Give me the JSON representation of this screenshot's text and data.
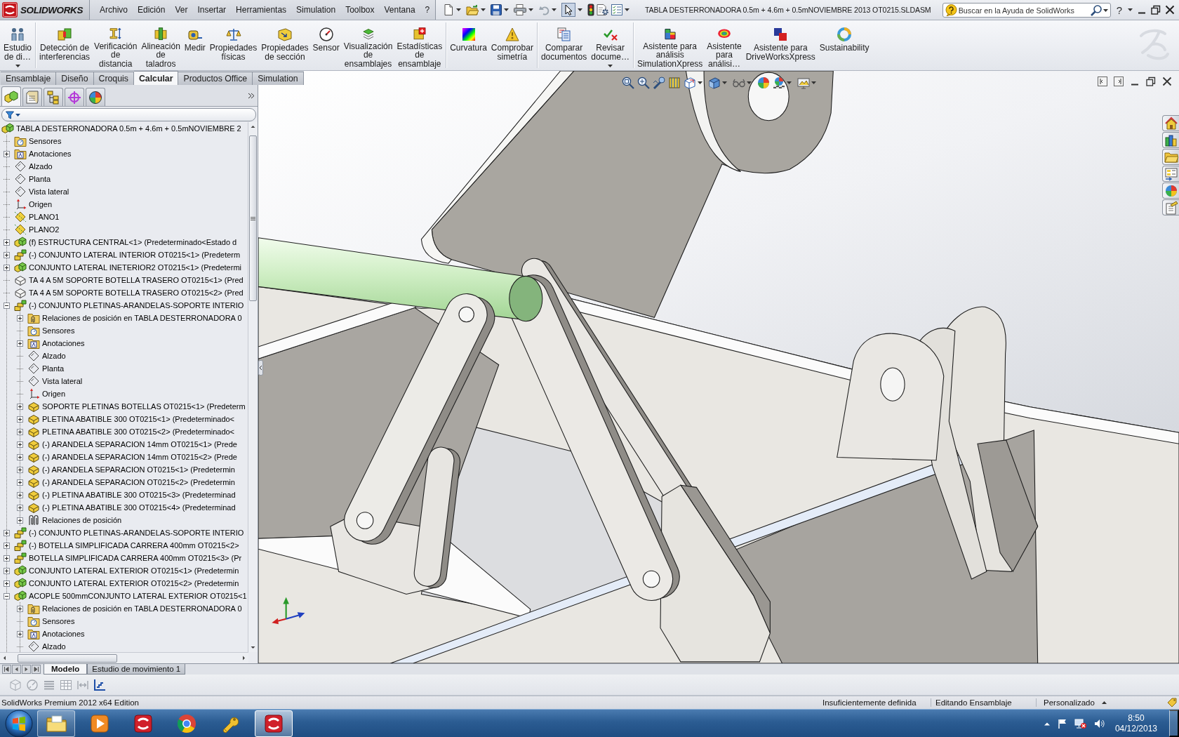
{
  "logo": {
    "text": "SOLIDWORKS"
  },
  "menu": [
    "Archivo",
    "Edición",
    "Ver",
    "Insertar",
    "Herramientas",
    "Simulation",
    "Toolbox",
    "Ventana",
    "?"
  ],
  "window": {
    "title": "TABLA DESTERRONADORA 0.5m + 4.6m + 0.5mNOVIEMBRE 2013 OT0215.SLDASM"
  },
  "search": {
    "placeholder": "Buscar en la Ayuda de SolidWorks"
  },
  "help_button": {
    "label": "?"
  },
  "ribbon": {
    "groups": [
      {
        "commands": [
          {
            "label": "Estudio de di…",
            "menu": true
          }
        ]
      },
      {
        "commands": [
          {
            "label": "Detección de interferencias",
            "menu": false
          },
          {
            "label": "Verificación de distancia",
            "menu": false
          },
          {
            "label": "Alineación de taladros",
            "menu": false
          },
          {
            "label": "Medir",
            "menu": false
          },
          {
            "label": "Propiedades físicas",
            "menu": false
          },
          {
            "label": "Propiedades de sección",
            "menu": false
          },
          {
            "label": "Sensor",
            "menu": false
          },
          {
            "label": "Visualización de ensamblajes",
            "menu": false
          },
          {
            "label": "Estadísticas de ensamblaje",
            "menu": false
          }
        ]
      },
      {
        "commands": [
          {
            "label": "Curvatura",
            "menu": false
          },
          {
            "label": "Comprobar simetría",
            "menu": false
          }
        ]
      },
      {
        "commands": [
          {
            "label": "Comparar documentos",
            "menu": false
          },
          {
            "label": "Revisar docume…",
            "menu": true
          }
        ]
      },
      {
        "commands": [
          {
            "label": "Asistente para análisis SimulationXpress",
            "menu": false
          },
          {
            "label": "Asistente para análisi…",
            "menu": false
          },
          {
            "label": "Asistente para DriveWorksXpress",
            "menu": false
          },
          {
            "label": "Sustainability",
            "menu": false
          }
        ]
      }
    ]
  },
  "command_tabs": [
    {
      "label": "Ensamblaje",
      "selected": false
    },
    {
      "label": "Diseño",
      "selected": false
    },
    {
      "label": "Croquis",
      "selected": false
    },
    {
      "label": "Calcular",
      "selected": true
    },
    {
      "label": "Productos Office",
      "selected": false
    },
    {
      "label": "Simulation",
      "selected": false
    }
  ],
  "panel_tabs": [
    {
      "kind": "features",
      "selected": true
    },
    {
      "kind": "properties",
      "selected": false
    },
    {
      "kind": "configurations",
      "selected": false
    },
    {
      "kind": "dimxpert",
      "selected": false
    },
    {
      "kind": "display",
      "selected": false
    }
  ],
  "feature_tree": {
    "items": [
      {
        "label": "TABLA DESTERRONADORA 0.5m + 4.6m + 0.5mNOVIEMBRE 2",
        "kind": "assembly",
        "children": [
          {
            "label": "Sensores",
            "kind": "sensors"
          },
          {
            "label": "Anotaciones",
            "kind": "annotations",
            "expanded": false
          },
          {
            "label": "Alzado",
            "kind": "plane"
          },
          {
            "label": "Planta",
            "kind": "plane"
          },
          {
            "label": "Vista lateral",
            "kind": "plane"
          },
          {
            "label": "Origen",
            "kind": "origin"
          },
          {
            "label": "PLANO1",
            "kind": "refplane"
          },
          {
            "label": "PLANO2",
            "kind": "refplane"
          },
          {
            "label": "(f) ESTRUCTURA CENTRAL<1> (Predeterminado<Estado d",
            "kind": "assembly",
            "expanded": false
          },
          {
            "label": "(-) CONJUNTO LATERAL INTERIOR OT0215<1> (Predeterm",
            "kind": "flexible",
            "expanded": false
          },
          {
            "label": "CONJUNTO LATERAL INETERIOR2 OT0215<1> (Predetermi",
            "kind": "assembly",
            "expanded": false
          },
          {
            "label": "TA 4 A 5M SOPORTE BOTELLA TRASERO OT0215<1> (Pred",
            "kind": "wirepart"
          },
          {
            "label": "TA 4 A 5M SOPORTE BOTELLA TRASERO OT0215<2> (Pred",
            "kind": "wirepart"
          },
          {
            "label": "(-) CONJUNTO PLETINAS-ARANDELAS-SOPORTE INTERIO",
            "kind": "flexible",
            "expanded": true,
            "children": [
              {
                "label": "Relaciones de posición en TABLA DESTERRONADORA 0",
                "kind": "matesfolder",
                "expanded": false
              },
              {
                "label": "Sensores",
                "kind": "sensors"
              },
              {
                "label": "Anotaciones",
                "kind": "annotations",
                "expanded": false
              },
              {
                "label": "Alzado",
                "kind": "plane"
              },
              {
                "label": "Planta",
                "kind": "plane"
              },
              {
                "label": "Vista lateral",
                "kind": "plane"
              },
              {
                "label": "Origen",
                "kind": "origin"
              },
              {
                "label": "SOPORTE PLETINAS BOTELLAS OT0215<1> (Predeterm",
                "kind": "part",
                "expanded": false
              },
              {
                "label": "PLETINA ABATIBLE 300 OT0215<1> (Predeterminado<",
                "kind": "part",
                "expanded": false
              },
              {
                "label": "PLETINA ABATIBLE 300 OT0215<2> (Predeterminado<",
                "kind": "part",
                "expanded": false
              },
              {
                "label": "(-) ARANDELA SEPARACION 14mm OT0215<1> (Prede",
                "kind": "part",
                "expanded": false
              },
              {
                "label": "(-) ARANDELA SEPARACION 14mm OT0215<2> (Prede",
                "kind": "part",
                "expanded": false
              },
              {
                "label": "(-) ARANDELA SEPARACION OT0215<1> (Predetermin",
                "kind": "part",
                "expanded": false
              },
              {
                "label": "(-) ARANDELA SEPARACION OT0215<2> (Predetermin",
                "kind": "part",
                "expanded": false
              },
              {
                "label": "(-) PLETINA ABATIBLE 300 OT0215<3> (Predeterminad",
                "kind": "part",
                "expanded": false
              },
              {
                "label": "(-) PLETINA ABATIBLE 300 OT0215<4> (Predeterminad",
                "kind": "part",
                "expanded": false
              },
              {
                "label": "Relaciones de posición",
                "kind": "mates",
                "expanded": false
              }
            ]
          },
          {
            "label": "(-) CONJUNTO PLETINAS-ARANDELAS-SOPORTE INTERIO",
            "kind": "flexible",
            "expanded": false
          },
          {
            "label": "(-) BOTELLA SIMPLIFICADA CARRERA 400mm OT0215<2>",
            "kind": "flexible",
            "expanded": false
          },
          {
            "label": "BOTELLA SIMPLIFICADA CARRERA 400mm OT0215<3> (Pr",
            "kind": "flexible",
            "expanded": false
          },
          {
            "label": "CONJUNTO LATERAL EXTERIOR OT0215<1> (Predetermin",
            "kind": "assembly",
            "expanded": false
          },
          {
            "label": "CONJUNTO LATERAL EXTERIOR OT0215<2> (Predetermin",
            "kind": "assembly",
            "expanded": false
          },
          {
            "label": "ACOPLE 500mmCONJUNTO LATERAL EXTERIOR OT0215<1",
            "kind": "assembly",
            "expanded": true,
            "children": [
              {
                "label": "Relaciones de posición en TABLA DESTERRONADORA 0",
                "kind": "matesfolder",
                "expanded": false
              },
              {
                "label": "Sensores",
                "kind": "sensors"
              },
              {
                "label": "Anotaciones",
                "kind": "annotations",
                "expanded": false
              },
              {
                "label": "Alzado",
                "kind": "plane"
              }
            ]
          }
        ]
      }
    ]
  },
  "model_tabs": [
    {
      "label": "Modelo",
      "selected": true
    },
    {
      "label": "Estudio de movimiento 1",
      "selected": false
    }
  ],
  "motion_toolbar": [
    {
      "kind": "box",
      "disabled": true
    },
    {
      "kind": "dial",
      "disabled": true
    },
    {
      "kind": "list",
      "disabled": true
    },
    {
      "kind": "grid",
      "disabled": true
    },
    {
      "kind": "split",
      "disabled": true
    },
    {
      "kind": "chart",
      "disabled": false
    }
  ],
  "status_bar": {
    "edition": "SolidWorks Premium 2012 x64 Edition",
    "definition": "Insuficientemente definida",
    "mode": "Editando Ensamblaje",
    "units": "Personalizado"
  },
  "taskbar": {
    "apps": [
      {
        "kind": "explorer",
        "running": true,
        "selected": false
      },
      {
        "kind": "media",
        "running": false,
        "selected": false
      },
      {
        "kind": "solidworks",
        "running": false,
        "selected": false
      },
      {
        "kind": "chrome",
        "running": false,
        "selected": false
      },
      {
        "kind": "tool",
        "running": false,
        "selected": false
      },
      {
        "kind": "solidworks",
        "running": true,
        "selected": true
      }
    ],
    "time": "8:50",
    "date": "04/12/2013"
  }
}
